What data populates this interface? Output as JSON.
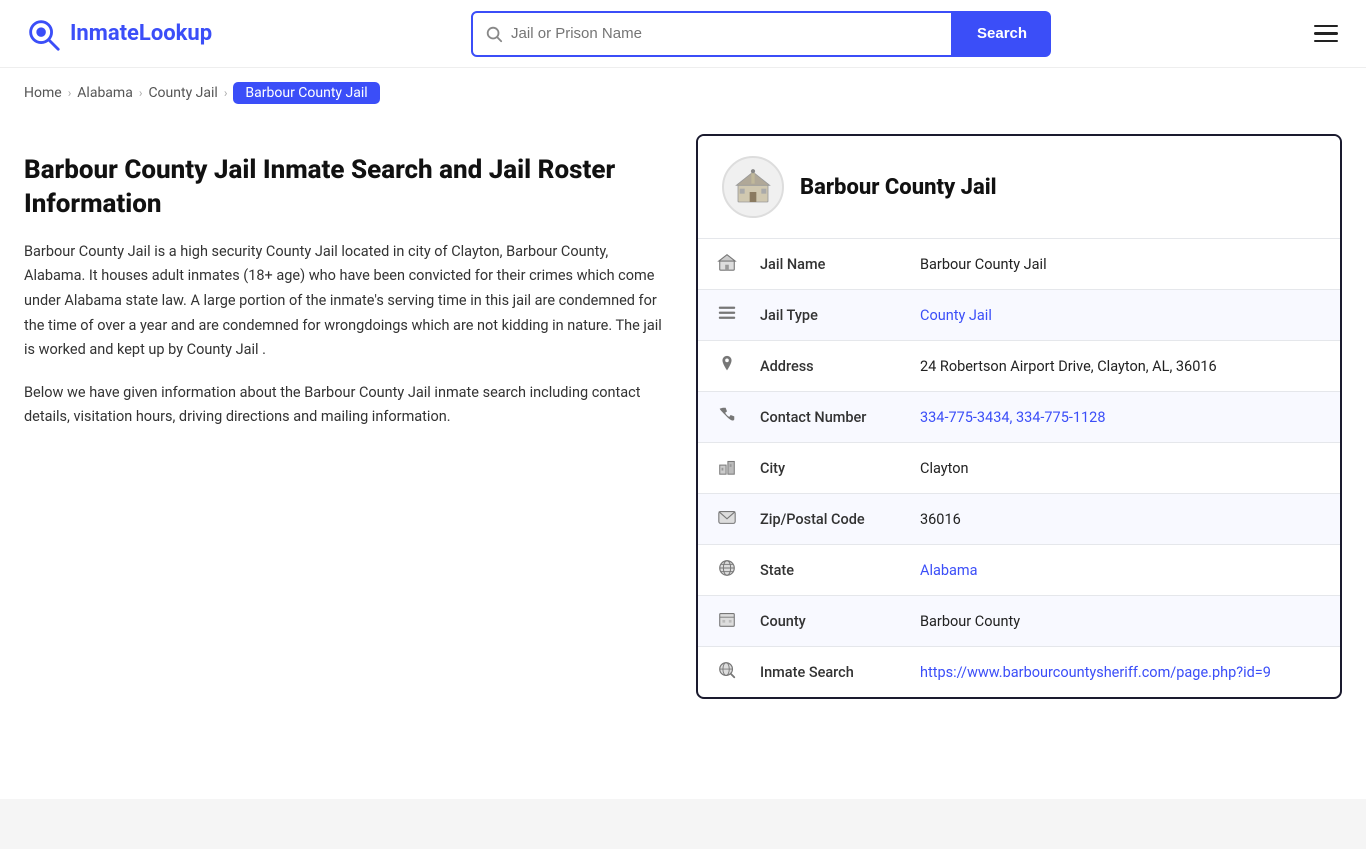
{
  "logo": {
    "brand": "InmateLookup",
    "brand_part1": "Inmate",
    "brand_part2": "Lookup"
  },
  "search": {
    "placeholder": "Jail or Prison Name",
    "button_label": "Search",
    "value": ""
  },
  "breadcrumb": {
    "items": [
      {
        "label": "Home",
        "href": "#"
      },
      {
        "label": "Alabama",
        "href": "#"
      },
      {
        "label": "County Jail",
        "href": "#"
      },
      {
        "label": "Barbour County Jail",
        "active": true
      }
    ]
  },
  "left": {
    "heading": "Barbour County Jail Inmate Search and Jail Roster Information",
    "para1": "Barbour County Jail is a high security County Jail located in city of Clayton, Barbour County, Alabama. It houses adult inmates (18+ age) who have been convicted for their crimes which come under Alabama state law. A large portion of the inmate's serving time in this jail are condemned for the time of over a year and are condemned for wrongdoings which are not kidding in nature. The jail is worked and kept up by County Jail .",
    "para2": "Below we have given information about the Barbour County Jail inmate search including contact details, visitation hours, driving directions and mailing information."
  },
  "card": {
    "title": "Barbour County Jail",
    "rows": [
      {
        "icon": "jail-icon",
        "label": "Jail Name",
        "value": "Barbour County Jail",
        "link": null
      },
      {
        "icon": "list-icon",
        "label": "Jail Type",
        "value": "County Jail",
        "link": "#"
      },
      {
        "icon": "location-icon",
        "label": "Address",
        "value": "24 Robertson Airport Drive, Clayton, AL, 36016",
        "link": null
      },
      {
        "icon": "phone-icon",
        "label": "Contact Number",
        "value": "334-775-3434, 334-775-1128",
        "link": "#"
      },
      {
        "icon": "city-icon",
        "label": "City",
        "value": "Clayton",
        "link": null
      },
      {
        "icon": "mail-icon",
        "label": "Zip/Postal Code",
        "value": "36016",
        "link": null
      },
      {
        "icon": "globe-icon",
        "label": "State",
        "value": "Alabama",
        "link": "#"
      },
      {
        "icon": "county-icon",
        "label": "County",
        "value": "Barbour County",
        "link": null
      },
      {
        "icon": "search-globe-icon",
        "label": "Inmate Search",
        "value": "https://www.barbourcountysheriff.com/page.php?id=9",
        "link": "https://www.barbourcountysheriff.com/page.php?id=9"
      }
    ]
  },
  "colors": {
    "accent": "#3b4ef8",
    "dark": "#1a1a2e"
  }
}
